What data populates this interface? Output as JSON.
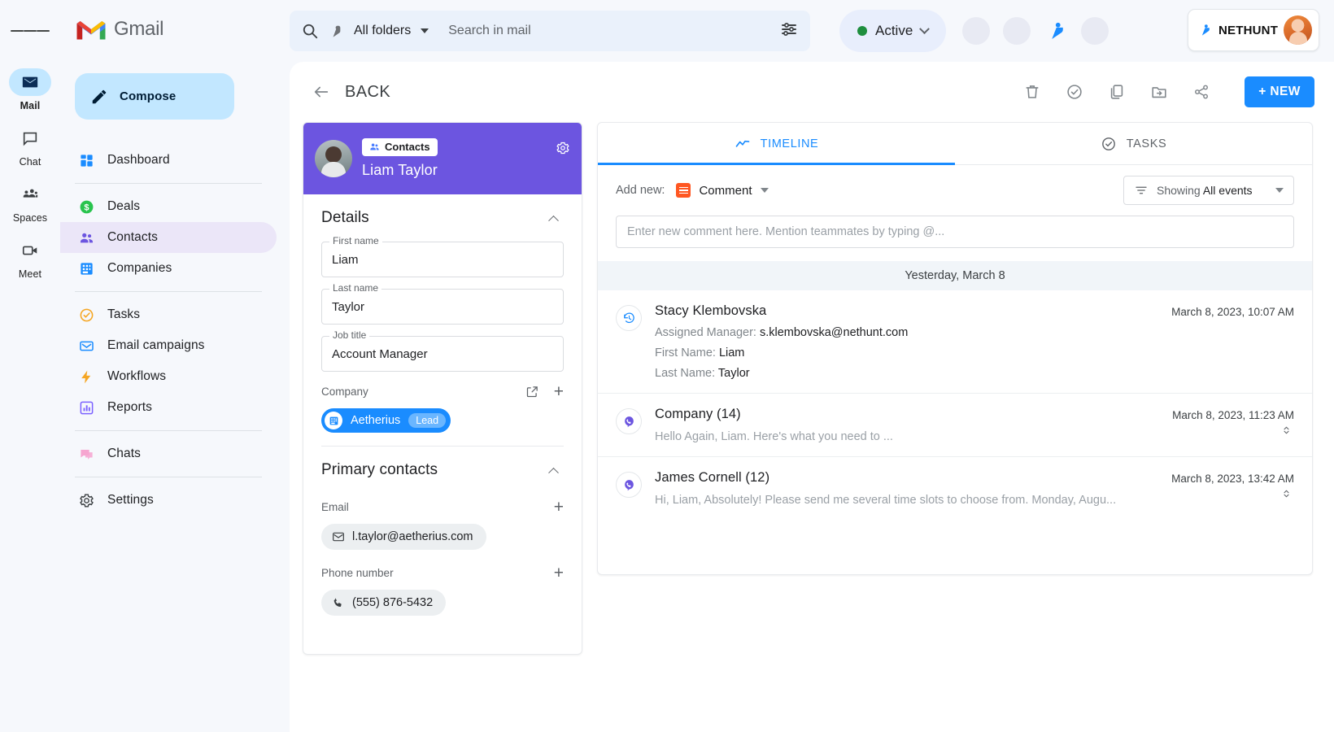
{
  "rail": {
    "menu_icon": "hamburger-icon",
    "items": [
      {
        "label": "Mail",
        "icon": "mail-icon",
        "active": true
      },
      {
        "label": "Chat",
        "icon": "chat-icon",
        "active": false
      },
      {
        "label": "Spaces",
        "icon": "spaces-icon",
        "active": false
      },
      {
        "label": "Meet",
        "icon": "meet-icon",
        "active": false
      }
    ]
  },
  "sidebar": {
    "brand": "Gmail",
    "compose_label": "Compose",
    "groups": [
      {
        "items": [
          {
            "label": "Dashboard",
            "icon": "dashboard-icon",
            "selected": false
          }
        ]
      },
      {
        "items": [
          {
            "label": "Deals",
            "icon": "deals-icon",
            "selected": false
          },
          {
            "label": "Contacts",
            "icon": "contacts-icon",
            "selected": true
          },
          {
            "label": "Companies",
            "icon": "companies-icon",
            "selected": false
          }
        ]
      },
      {
        "items": [
          {
            "label": "Tasks",
            "icon": "tasks-icon",
            "selected": false
          },
          {
            "label": "Email campaigns",
            "icon": "email-campaigns-icon",
            "selected": false
          },
          {
            "label": "Workflows",
            "icon": "workflows-icon",
            "selected": false
          },
          {
            "label": "Reports",
            "icon": "reports-icon",
            "selected": false
          }
        ]
      },
      {
        "items": [
          {
            "label": "Chats",
            "icon": "chats-icon",
            "selected": false
          }
        ]
      },
      {
        "items": [
          {
            "label": "Settings",
            "icon": "settings-icon",
            "selected": false
          }
        ]
      }
    ]
  },
  "topbar": {
    "search_scope": "All folders",
    "search_placeholder": "Search in mail",
    "search_value": "",
    "status": "Active",
    "brand_badge": "NETHUNT"
  },
  "header": {
    "back_label": "BACK",
    "actions": [
      "delete-icon",
      "task-icon",
      "copy-icon",
      "move-to-folder-icon",
      "share-icon"
    ],
    "new_button": "+ NEW"
  },
  "contact": {
    "record_type": "Contacts",
    "name": "Liam Taylor",
    "details_title": "Details",
    "fields": [
      {
        "label": "First name",
        "value": "Liam"
      },
      {
        "label": "Last name",
        "value": "Taylor"
      },
      {
        "label": "Job title",
        "value": "Account Manager"
      }
    ],
    "company_label": "Company",
    "company_name": "Aetherius",
    "company_tag": "Lead",
    "primary_contacts_title": "Primary contacts",
    "email_label": "Email",
    "email_value": "l.taylor@aetherius.com",
    "phone_label": "Phone number",
    "phone_value": "(555) 876-5432"
  },
  "timeline": {
    "tabs": [
      {
        "label": "TIMELINE",
        "icon": "timeline-icon",
        "active": true
      },
      {
        "label": "TASKS",
        "icon": "tasks-check-icon",
        "active": false
      }
    ],
    "add_new_label": "Add new:",
    "add_new_value": "Comment",
    "filter_prefix": "Showing ",
    "filter_value": "All events",
    "comment_placeholder": "Enter new comment here. Mention teammates by typing @...",
    "day_separator": "Yesterday, March 8",
    "events": [
      {
        "icon": "history-icon",
        "title": "Stacy Klembovska",
        "time": "March 8, 2023, 10:07 AM",
        "lines": [
          {
            "label": "Assigned Manager: ",
            "value": "s.klembovska@nethunt.com"
          },
          {
            "label": "First Name: ",
            "value": "Liam"
          },
          {
            "label": "Last Name: ",
            "value": "Taylor"
          }
        ],
        "snippet": "",
        "expandable": false
      },
      {
        "icon": "viber-icon",
        "title": "Company (14)",
        "time": "March 8, 2023, 11:23 AM",
        "lines": [],
        "snippet": "Hello Again, Liam. Here's what you need to ...",
        "expandable": true
      },
      {
        "icon": "viber-icon",
        "title": "James Cornell (12)",
        "time": "March 8, 2023, 13:42 AM",
        "lines": [],
        "snippet": "Hi, Liam, Absolutely! Please send me several time slots to choose from. Monday, Augu...",
        "expandable": true
      }
    ]
  },
  "colors": {
    "accent_blue": "#1a8cff",
    "purple_banner": "#6c55e0",
    "selected_nav": "#ebe6f8",
    "compose_blue": "#c2e7ff",
    "status_green": "#1e8e3e"
  }
}
